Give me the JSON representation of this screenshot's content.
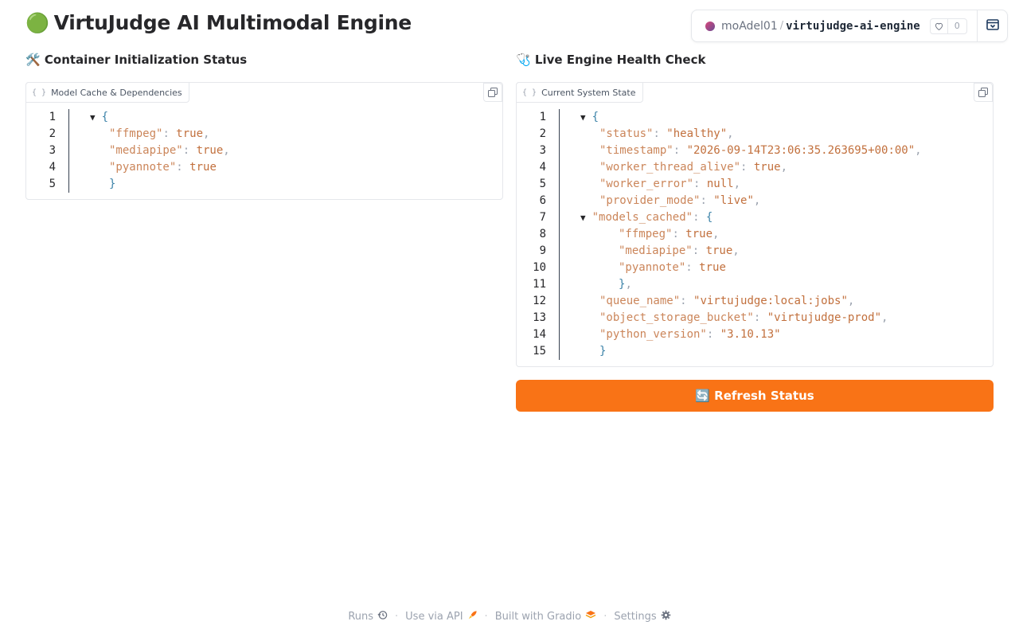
{
  "header": {
    "title": "VirtuJudge AI Multimodal Engine",
    "title_emoji": "🟢"
  },
  "space": {
    "owner": "moAdel01",
    "separator": "/",
    "repo": "virtujudge-ai-engine",
    "likes": "0"
  },
  "left": {
    "section_title": "🛠️ Container Initialization Status",
    "panel_label": "Model Cache & Dependencies",
    "lines": [
      {
        "num": "1",
        "indent": 0,
        "tri": "▼",
        "parts": [
          [
            "brace",
            "{"
          ]
        ]
      },
      {
        "num": "2",
        "indent": 1,
        "parts": [
          [
            "key",
            "\"ffmpeg\""
          ],
          [
            "punct",
            ": "
          ],
          [
            "val",
            "true"
          ],
          [
            "punct",
            ","
          ]
        ]
      },
      {
        "num": "3",
        "indent": 1,
        "parts": [
          [
            "key",
            "\"mediapipe\""
          ],
          [
            "punct",
            ": "
          ],
          [
            "val",
            "true"
          ],
          [
            "punct",
            ","
          ]
        ]
      },
      {
        "num": "4",
        "indent": 1,
        "parts": [
          [
            "key",
            "\"pyannote\""
          ],
          [
            "punct",
            ": "
          ],
          [
            "val",
            "true"
          ]
        ]
      },
      {
        "num": "5",
        "indent": 1,
        "parts": [
          [
            "brace",
            "}"
          ]
        ]
      }
    ]
  },
  "right": {
    "section_title": "🩺 Live Engine Health Check",
    "panel_label": "Current System State",
    "lines": [
      {
        "num": "1",
        "indent": 0,
        "tri": "▼",
        "parts": [
          [
            "brace",
            "{"
          ]
        ]
      },
      {
        "num": "2",
        "indent": 1,
        "parts": [
          [
            "key",
            "\"status\""
          ],
          [
            "punct",
            ": "
          ],
          [
            "val",
            "\"healthy\""
          ],
          [
            "punct",
            ","
          ]
        ]
      },
      {
        "num": "3",
        "indent": 1,
        "parts": [
          [
            "key",
            "\"timestamp\""
          ],
          [
            "punct",
            ": "
          ],
          [
            "val",
            "\"2026-09-14T23:06:35.263695+00:00\""
          ],
          [
            "punct",
            ","
          ]
        ]
      },
      {
        "num": "4",
        "indent": 1,
        "parts": [
          [
            "key",
            "\"worker_thread_alive\""
          ],
          [
            "punct",
            ": "
          ],
          [
            "val",
            "true"
          ],
          [
            "punct",
            ","
          ]
        ]
      },
      {
        "num": "5",
        "indent": 1,
        "parts": [
          [
            "key",
            "\"worker_error\""
          ],
          [
            "punct",
            ": "
          ],
          [
            "val",
            "null"
          ],
          [
            "punct",
            ","
          ]
        ]
      },
      {
        "num": "6",
        "indent": 1,
        "parts": [
          [
            "key",
            "\"provider_mode\""
          ],
          [
            "punct",
            ": "
          ],
          [
            "val",
            "\"live\""
          ],
          [
            "punct",
            ","
          ]
        ]
      },
      {
        "num": "7",
        "indent": 1,
        "tri": "▼",
        "parts": [
          [
            "key",
            "\"models_cached\""
          ],
          [
            "punct",
            ": "
          ],
          [
            "brace",
            "{"
          ]
        ]
      },
      {
        "num": "8",
        "indent": 2,
        "parts": [
          [
            "key",
            "\"ffmpeg\""
          ],
          [
            "punct",
            ": "
          ],
          [
            "val",
            "true"
          ],
          [
            "punct",
            ","
          ]
        ]
      },
      {
        "num": "9",
        "indent": 2,
        "parts": [
          [
            "key",
            "\"mediapipe\""
          ],
          [
            "punct",
            ": "
          ],
          [
            "val",
            "true"
          ],
          [
            "punct",
            ","
          ]
        ]
      },
      {
        "num": "10",
        "indent": 2,
        "parts": [
          [
            "key",
            "\"pyannote\""
          ],
          [
            "punct",
            ": "
          ],
          [
            "val",
            "true"
          ]
        ]
      },
      {
        "num": "11",
        "indent": 2,
        "parts": [
          [
            "brace",
            "}"
          ],
          [
            "punct",
            ","
          ]
        ]
      },
      {
        "num": "12",
        "indent": 1,
        "parts": [
          [
            "key",
            "\"queue_name\""
          ],
          [
            "punct",
            ": "
          ],
          [
            "val",
            "\"virtujudge:local:jobs\""
          ],
          [
            "punct",
            ","
          ]
        ]
      },
      {
        "num": "13",
        "indent": 1,
        "parts": [
          [
            "key",
            "\"object_storage_bucket\""
          ],
          [
            "punct",
            ": "
          ],
          [
            "val",
            "\"virtujudge-prod\""
          ],
          [
            "punct",
            ","
          ]
        ]
      },
      {
        "num": "14",
        "indent": 1,
        "parts": [
          [
            "key",
            "\"python_version\""
          ],
          [
            "punct",
            ": "
          ],
          [
            "val",
            "\"3.10.13\""
          ]
        ]
      },
      {
        "num": "15",
        "indent": 1,
        "parts": [
          [
            "brace",
            "}"
          ]
        ]
      }
    ]
  },
  "actions": {
    "refresh_label": "🔄 Refresh Status"
  },
  "footer": {
    "runs": "Runs",
    "api": "Use via API",
    "built": "Built with Gradio",
    "settings": "Settings",
    "sep": "·"
  },
  "colors": {
    "accent": "#f97316",
    "json_value": "#c2703d"
  }
}
